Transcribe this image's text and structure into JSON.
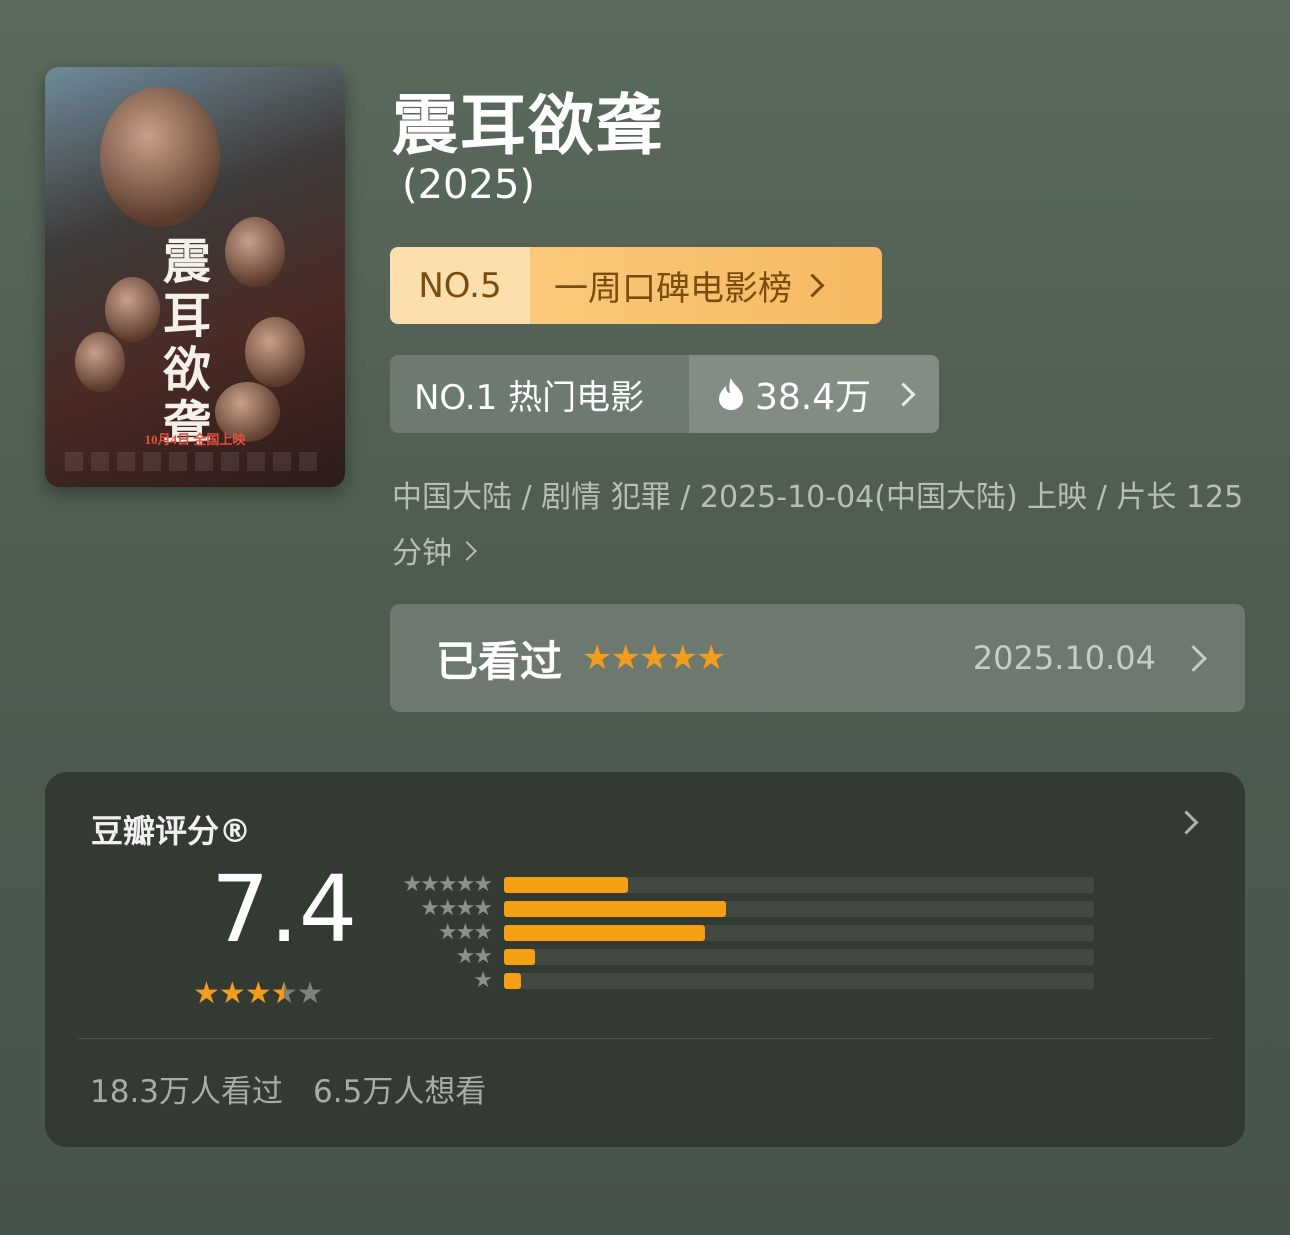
{
  "movie": {
    "title": "震耳欲聋",
    "year": "(2025)",
    "poster": {
      "title_vertical": "震耳欲聋",
      "release_text": "10月4日 全国上映"
    }
  },
  "rankings": {
    "weekly": {
      "no": "NO.5",
      "label": "一周口碑电影榜"
    },
    "hot": {
      "label": "NO.1 热门电影",
      "heat": "38.4万"
    }
  },
  "meta": {
    "line": "中国大陆 / 剧情 犯罪 / 2025-10-04(中国大陆) 上映 / 片长 125 分钟"
  },
  "watched": {
    "label": "已看过",
    "stars": "★★★★★",
    "date": "2025.10.04"
  },
  "rating": {
    "header": "豆瓣评分®",
    "score": "7.4",
    "score_stars": 3.5,
    "distribution": [
      {
        "stars": "★★★★★",
        "fraction": 0.21
      },
      {
        "stars": "★★★★",
        "fraction": 0.376
      },
      {
        "stars": "★★★",
        "fraction": 0.341
      },
      {
        "stars": "★★",
        "fraction": 0.053
      },
      {
        "stars": "★",
        "fraction": 0.029
      }
    ],
    "watched_count": "18.3万人看过",
    "want_count": "6.5万人想看"
  },
  "colors": {
    "accent_orange": "#f29d1e",
    "bar_orange": "#f4a012",
    "rank_weekly_bg": "#f9c97a"
  }
}
